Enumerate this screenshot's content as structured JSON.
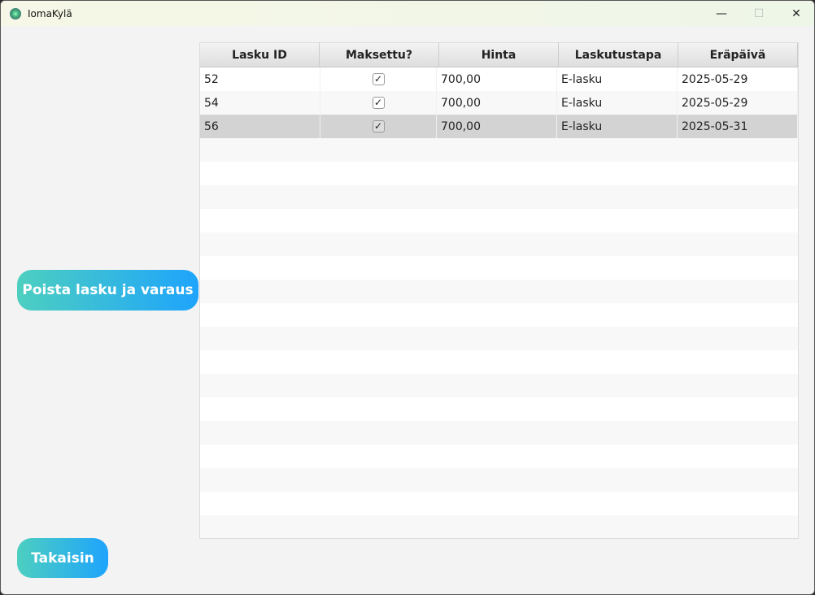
{
  "window": {
    "title": "IomaKylä",
    "minimize": "—",
    "maximize": "☐",
    "close": "✕"
  },
  "table": {
    "columns": [
      "Lasku ID",
      "Maksettu?",
      "Hinta",
      "Laskutustapa",
      "Eräpäivä"
    ],
    "rows": [
      {
        "id": "52",
        "paid": true,
        "price": "700,00",
        "method": "E-lasku",
        "due": "2025-05-29"
      },
      {
        "id": "54",
        "paid": true,
        "price": "700,00",
        "method": "E-lasku",
        "due": "2025-05-29"
      },
      {
        "id": "56",
        "paid": true,
        "price": "700,00",
        "method": "E-lasku",
        "due": "2025-05-31",
        "selected": true
      }
    ]
  },
  "buttons": {
    "delete": "Poista lasku ja varaus",
    "back": "Takaisin"
  },
  "colors": {
    "button_gradient_start": "#4dcfc0",
    "button_gradient_end": "#1ea4fc",
    "selected_row": "#d3d3d3"
  }
}
